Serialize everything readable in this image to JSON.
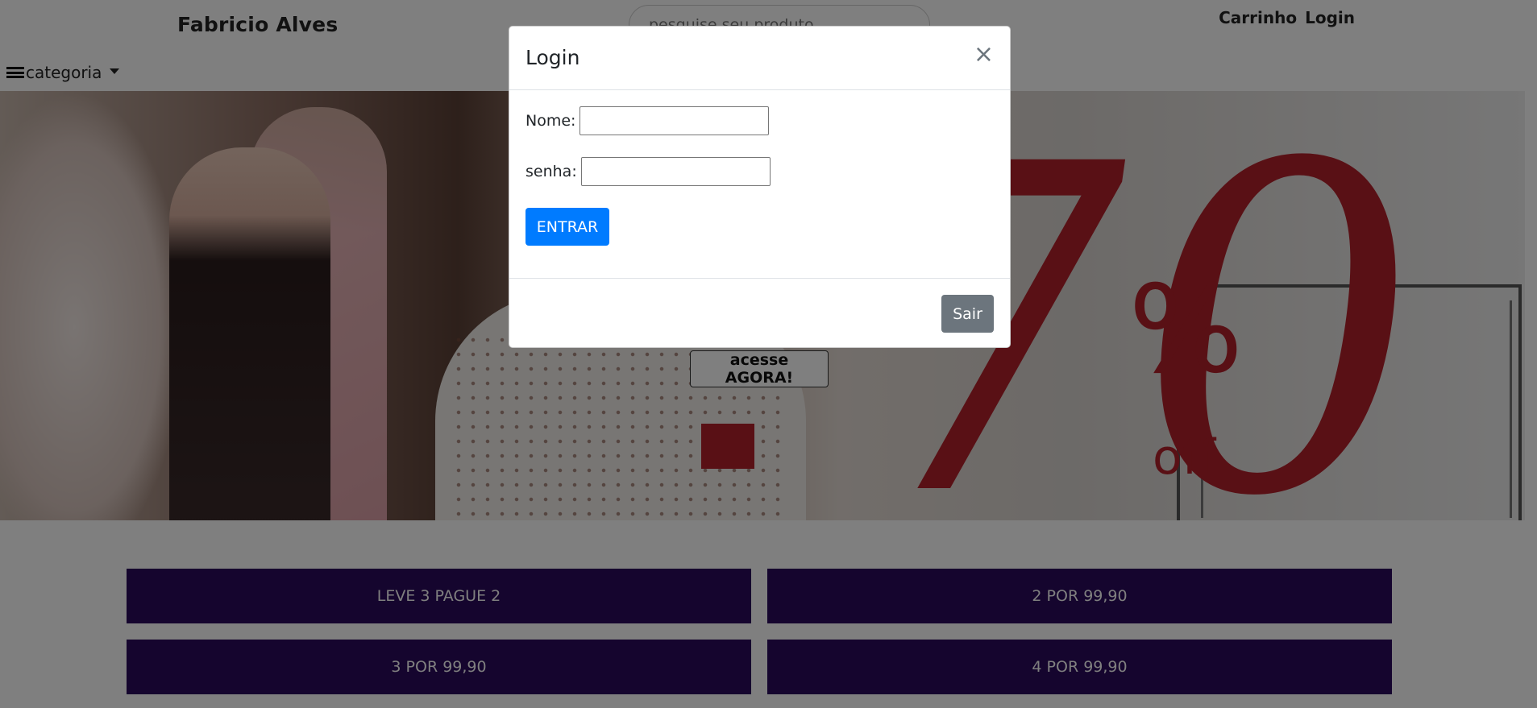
{
  "header": {
    "brand": "Fabricio Alves",
    "search_placeholder": "pesquise seu produto",
    "links": [
      "Carrinho",
      "Login"
    ],
    "category_label": "categoria"
  },
  "hero": {
    "cta_label": "acesse AGORA!",
    "graphic_text": {
      "big": "70",
      "percent": "%",
      "off": "off"
    }
  },
  "promos": [
    "LEVE 3 PAGUE 2",
    "2 POR 99,90",
    "3 POR 99,90",
    "4 POR 99,90"
  ],
  "modal": {
    "title": "Login",
    "close_symbol": "×",
    "fields": [
      {
        "label": "Nome:",
        "value": ""
      },
      {
        "label": "senha:",
        "value": ""
      }
    ],
    "submit_label": "ENTRAR",
    "dismiss_label": "Sair"
  },
  "colors": {
    "promo_bg": "#2b0a5c",
    "primary": "#007bff",
    "secondary": "#6c757d",
    "sale_red": "#b3202a"
  }
}
